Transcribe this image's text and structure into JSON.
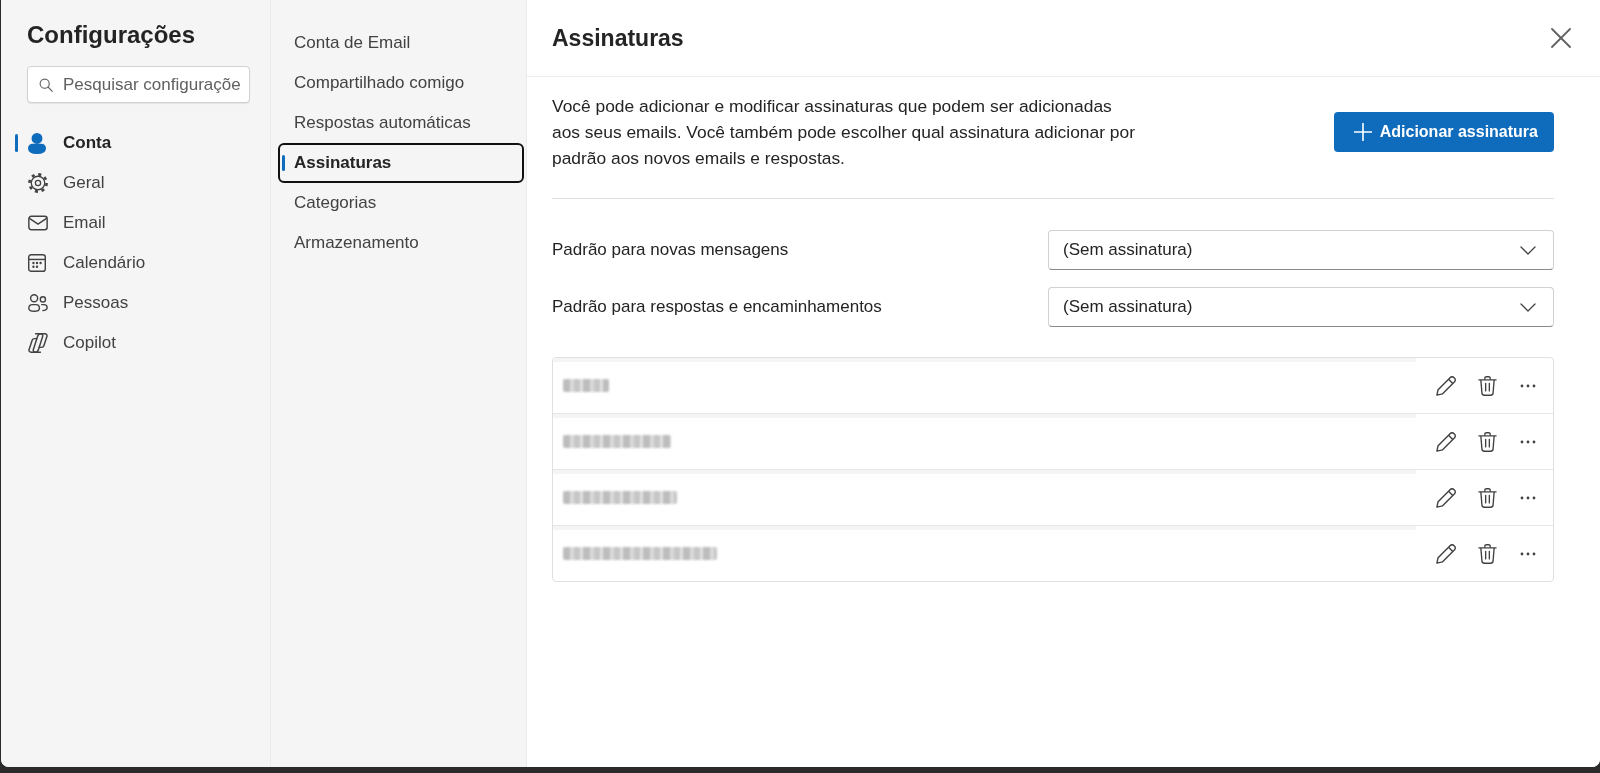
{
  "sidebar": {
    "title": "Configurações",
    "search": {
      "placeholder": "Pesquisar configuraçõe"
    },
    "items": [
      {
        "label": "Conta",
        "selected": true
      },
      {
        "label": "Geral",
        "selected": false
      },
      {
        "label": "Email",
        "selected": false
      },
      {
        "label": "Calendário",
        "selected": false
      },
      {
        "label": "Pessoas",
        "selected": false
      },
      {
        "label": "Copilot",
        "selected": false
      }
    ]
  },
  "subnav": [
    {
      "label": "Conta de Email",
      "selected": false,
      "focused": false
    },
    {
      "label": "Compartilhado comigo",
      "selected": false,
      "focused": false
    },
    {
      "label": "Respostas automáticas",
      "selected": false,
      "focused": false
    },
    {
      "label": "Assinaturas",
      "selected": true,
      "focused": true
    },
    {
      "label": "Categorias",
      "selected": false,
      "focused": false
    },
    {
      "label": "Armazenamento",
      "selected": false,
      "focused": false
    }
  ],
  "panel": {
    "title": "Assinaturas",
    "description": "Você pode adicionar e modificar assinaturas que podem ser adicionadas aos seus emails. Você também pode escolher qual assinatura adicionar por padrão aos novos emails e respostas.",
    "add_button": {
      "label": "Adicionar assinatura"
    },
    "defaults": [
      {
        "label": "Padrão para novas mensagens",
        "value": "(Sem assinatura)"
      },
      {
        "label": "Padrão para respostas e encaminhamentos",
        "value": "(Sem assinatura)"
      }
    ],
    "signatures": [
      {
        "kind": "blurred"
      },
      {
        "kind": "blurred"
      },
      {
        "kind": "blurred"
      },
      {
        "kind": "blurred"
      }
    ]
  }
}
